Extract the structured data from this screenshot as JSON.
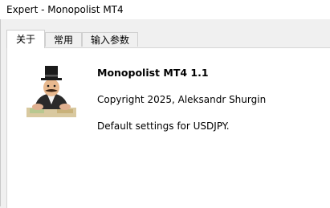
{
  "window": {
    "title": "Expert - Monopolist MT4"
  },
  "tabs": [
    {
      "label": "关于",
      "active": true
    },
    {
      "label": "常用",
      "active": false
    },
    {
      "label": "输入参数",
      "active": false
    }
  ],
  "about": {
    "name": "Monopolist MT4 1.1",
    "copyright": "Copyright 2025, Aleksandr Shurgin",
    "description": "Default settings for USDJPY.",
    "logo_icon": "monopolist-logo-icon"
  }
}
